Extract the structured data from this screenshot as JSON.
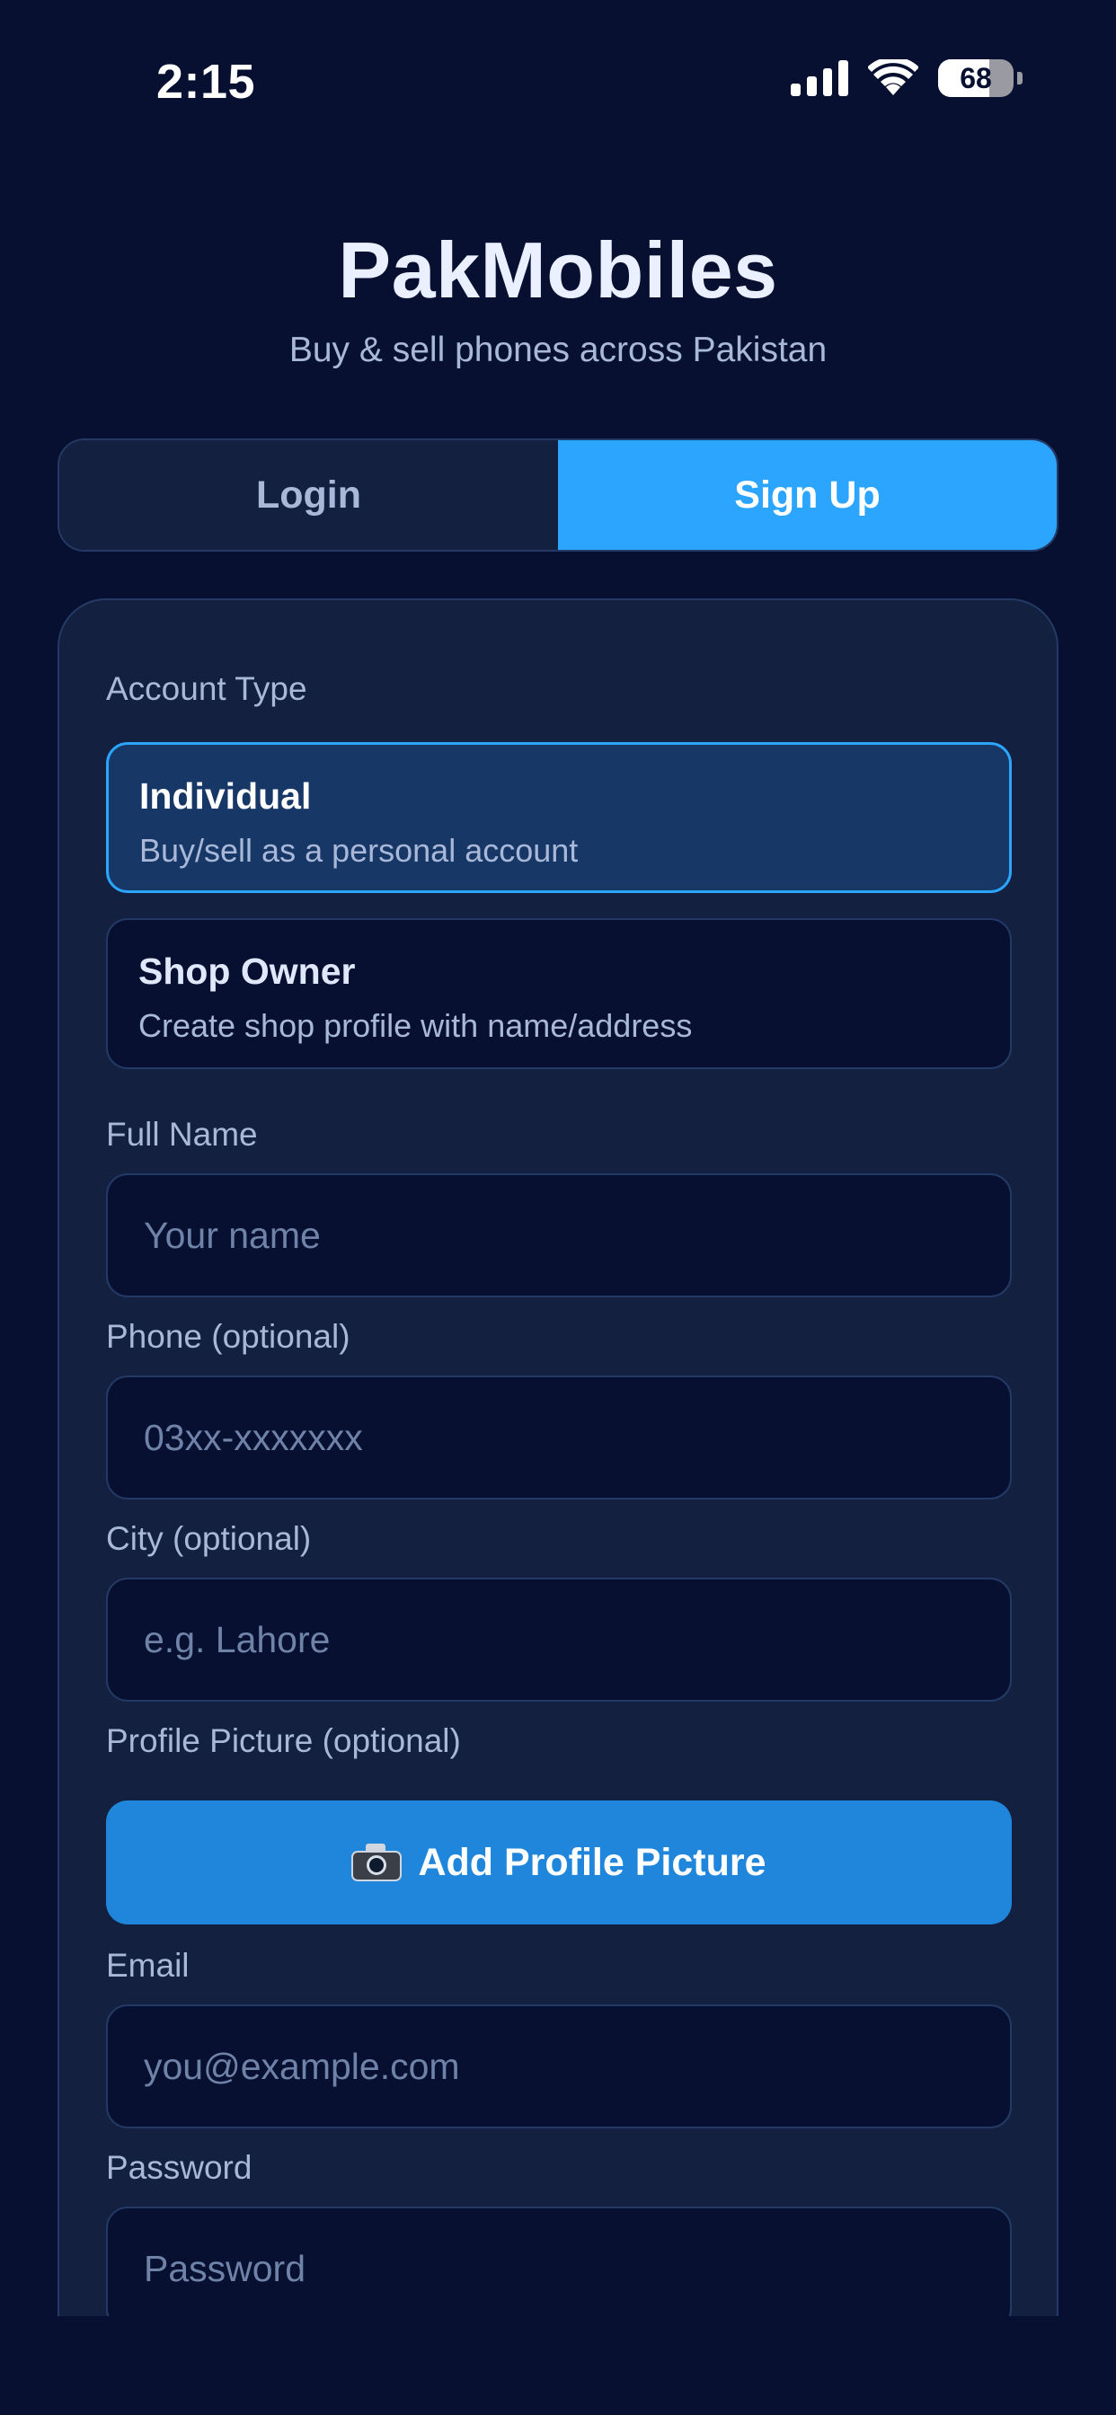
{
  "status_bar": {
    "time": "2:15",
    "battery": "68",
    "battery_level": 0.68
  },
  "header": {
    "title": "PakMobiles",
    "subtitle": "Buy & sell phones across Pakistan"
  },
  "tabs": {
    "login": "Login",
    "signup": "Sign Up",
    "active": "signup"
  },
  "form": {
    "account_type_label": "Account Type",
    "account_types": [
      {
        "title": "Individual",
        "description": "Buy/sell as a personal account",
        "selected": true
      },
      {
        "title": "Shop Owner",
        "description": "Create shop profile with name/address",
        "selected": false
      }
    ],
    "full_name": {
      "label": "Full Name",
      "placeholder": "Your name",
      "value": ""
    },
    "phone": {
      "label": "Phone (optional)",
      "placeholder": "03xx-xxxxxxx",
      "value": ""
    },
    "city": {
      "label": "City (optional)",
      "placeholder": "e.g. Lahore",
      "value": ""
    },
    "profile_picture": {
      "label": "Profile Picture (optional)",
      "button_label": "Add Profile Picture"
    },
    "email": {
      "label": "Email",
      "placeholder": "you@example.com",
      "value": ""
    },
    "password": {
      "label": "Password",
      "placeholder": "Password",
      "value": ""
    }
  },
  "colors": {
    "background": "#071030",
    "card": "#13203f",
    "accent": "#2ba5ff",
    "button": "#1f86dc",
    "selected_option": "#173866"
  },
  "icons": {
    "signal": "cellular-signal-icon",
    "wifi": "wifi-icon",
    "battery": "battery-icon",
    "camera": "camera-icon"
  }
}
